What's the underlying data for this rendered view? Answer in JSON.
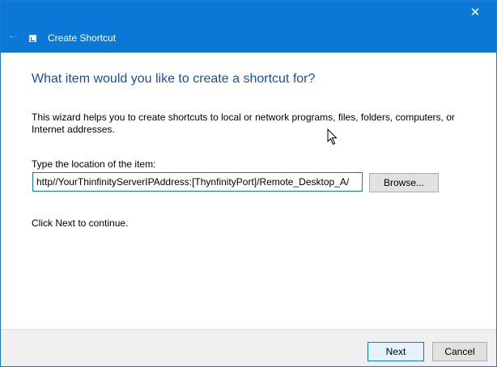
{
  "window": {
    "title": "Create Shortcut",
    "close_glyph": "✕",
    "back_glyph": "←"
  },
  "main": {
    "heading": "What item would you like to create a shortcut for?",
    "description": "This wizard helps you to create shortcuts to local or network programs, files, folders, computers, or Internet addresses.",
    "location_label": "Type the location of the item:",
    "location_value": "http//YourThinfinityServerIPAddress:[ThynfinityPort]/Remote_Desktop_A/",
    "browse_label": "Browse...",
    "continue_text": "Click Next to continue."
  },
  "footer": {
    "next_label": "Next",
    "cancel_label": "Cancel"
  },
  "colors": {
    "titlebar": "#0b78d7",
    "heading": "#1a4fa0",
    "input_border": "#0b78d7"
  },
  "icons": [
    "back-arrow-icon",
    "shortcut-app-icon",
    "close-icon",
    "mouse-cursor-icon"
  ]
}
